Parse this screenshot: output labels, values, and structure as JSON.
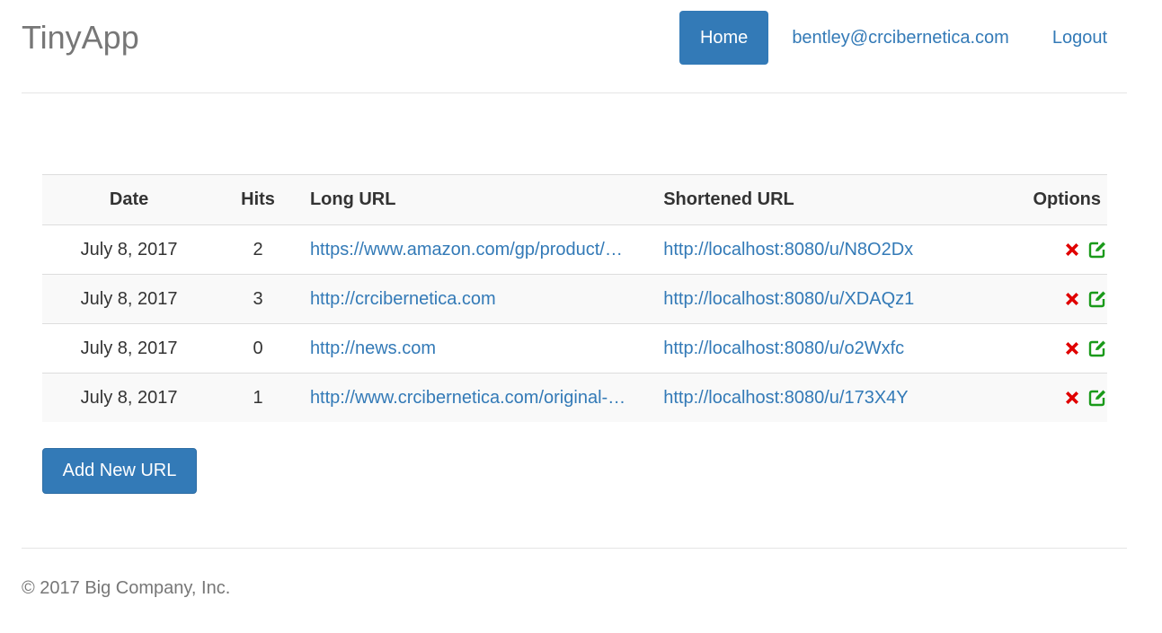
{
  "app": {
    "brand": "TinyApp"
  },
  "nav": {
    "home_label": "Home",
    "user_email": "bentley@crcibernetica.com",
    "logout_label": "Logout"
  },
  "table": {
    "headers": {
      "date": "Date",
      "hits": "Hits",
      "long_url": "Long URL",
      "short_url": "Shortened URL",
      "options": "Options"
    },
    "rows": [
      {
        "date": "July 8, 2017",
        "hits": "2",
        "long_url": "https://www.amazon.com/gp/product/…",
        "short_url": "http://localhost:8080/u/N8O2Dx"
      },
      {
        "date": "July 8, 2017",
        "hits": "3",
        "long_url": "http://crcibernetica.com",
        "short_url": "http://localhost:8080/u/XDAQz1"
      },
      {
        "date": "July 8, 2017",
        "hits": "0",
        "long_url": "http://news.com",
        "short_url": "http://localhost:8080/u/o2Wxfc"
      },
      {
        "date": "July 8, 2017",
        "hits": "1",
        "long_url": "http://www.crcibernetica.com/original-…",
        "short_url": "http://localhost:8080/u/173X4Y"
      }
    ],
    "icons": {
      "delete": "delete-x-icon",
      "edit": "edit-icon"
    }
  },
  "actions": {
    "add_label": "Add New URL"
  },
  "footer": {
    "copyright": "© 2017 Big Company, Inc."
  },
  "colors": {
    "primary": "#337ab7",
    "delete_red": "#e00000",
    "edit_green": "#1a9a1a",
    "muted": "#777777"
  }
}
